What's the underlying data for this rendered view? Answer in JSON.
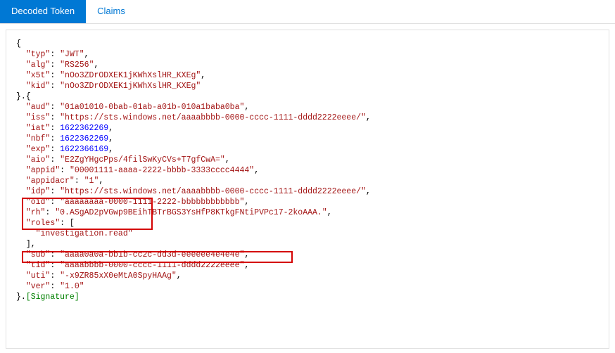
{
  "tabs": {
    "decoded": "Decoded Token",
    "claims": "Claims"
  },
  "token": {
    "header": {
      "typ": "JWT",
      "alg": "RS256",
      "x5t": "nOo3ZDrODXEK1jKWhXslHR_KXEg",
      "kid": "nOo3ZDrODXEK1jKWhXslHR_KXEg"
    },
    "payload": {
      "aud": "01a01010-0bab-01ab-a01b-010a1baba0ba",
      "iss": "https://sts.windows.net/aaaabbbb-0000-cccc-1111-dddd2222eeee/",
      "iat": 1622362269,
      "nbf": 1622362269,
      "exp": 1622366169,
      "aio": "E2ZgYHgcPps/4filSwKyCVs+T7gfCwA=",
      "appid": "00001111-aaaa-2222-bbbb-3333cccc4444",
      "appidacr": "1",
      "idp": "https://sts.windows.net/aaaabbbb-0000-cccc-1111-dddd2222eeee/",
      "oid": "aaaaaaaa-0000-1111-2222-bbbbbbbbbbbb",
      "rh": "0.ASgAD2pVGwp9BEihTBTrBGS3YsHfP8KTkgFNtiPVPc17-2koAAA.",
      "roles": [
        "investigation.read"
      ],
      "sub": "aaaa0a0a-bb1b-cc2c-dd3d-eeeeee4e4e4e",
      "tid": "aaaabbbb-0000-cccc-1111-dddd2222eeee",
      "uti": "-x9ZR85xX0eMtA0SpyHAAg",
      "ver": "1.0"
    },
    "signature_label": "[Signature]"
  }
}
